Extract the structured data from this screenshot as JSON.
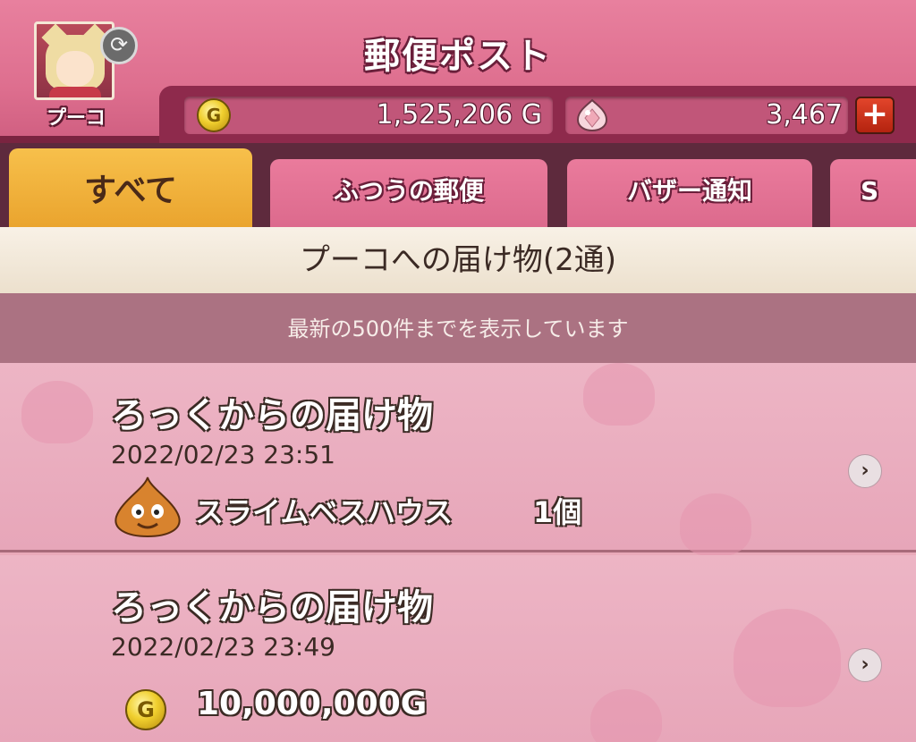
{
  "header": {
    "title": "郵便ポスト",
    "player_name": "プーコ",
    "gold": "1,525,206 G",
    "gems": "3,467",
    "coin_symbol": "G",
    "plus_symbol": "+"
  },
  "tabs": [
    {
      "label": "すべて",
      "active": true
    },
    {
      "label": "ふつうの郵便",
      "active": false
    },
    {
      "label": "バザー通知",
      "active": false
    },
    {
      "label": "S",
      "active": false
    }
  ],
  "section": {
    "title": "プーコへの届け物(2通)",
    "notice": "最新の500件までを表示しています"
  },
  "mails": [
    {
      "sender": "ろっくからの届け物",
      "date": "2022/02/23  23:51",
      "item_name": "スライムベスハウス",
      "item_qty": "1個",
      "icon": "slime-bess-icon"
    },
    {
      "sender": "ろっくからの届け物",
      "date": "2022/02/23  23:49",
      "gold_amount": "10,000,000G",
      "icon": "gold-coin-icon"
    }
  ],
  "icons": {
    "swap": "swap-character-icon",
    "chevron": "chevron-right-icon",
    "gem": "gem-icon"
  },
  "colors": {
    "header_pink": "#de6f8f",
    "active_tab": "#f7c04b",
    "list_bg": "#edb5c5"
  }
}
